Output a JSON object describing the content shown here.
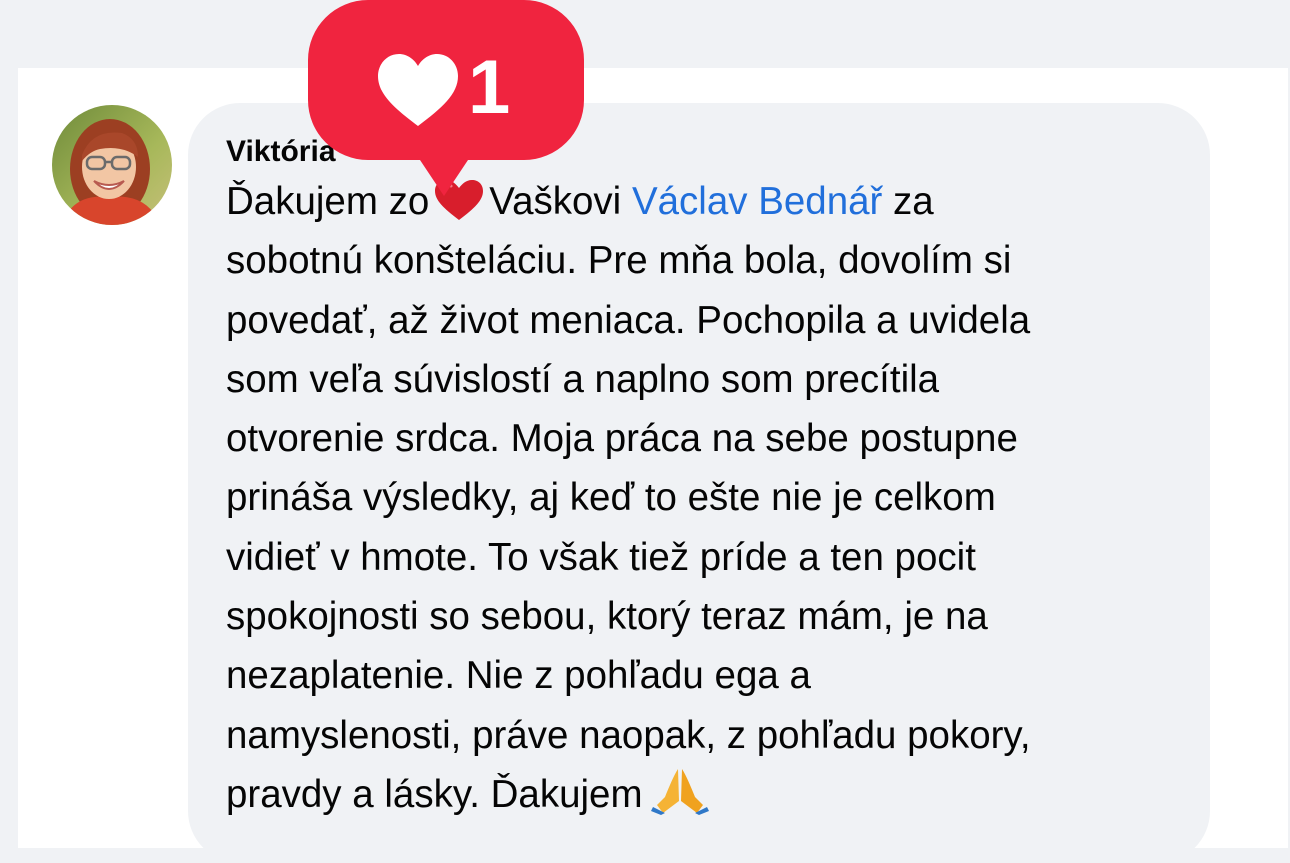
{
  "comment": {
    "author_name": "Viktória",
    "text_lines": [
      {
        "before": "Ďakujem zo",
        "emoji": "heart",
        "after": "Vaškovi",
        "mention": "Václav Bednář",
        "tail": "za"
      },
      "sobotnú konšteláciu. Pre mňa bola, dovolím si",
      "povedať, až život meniaca. Pochopila a uvidela",
      "som veľa súvislostí a naplno som precítila",
      "otvorenie srdca. Moja práca na sebe postupne",
      "prináša výsledky, aj keď to ešte nie je celkom",
      "vidieť v hmote. To však tiež príde a ten pocit",
      "spokojnosti so sebou, ktorý teraz mám, je na",
      "nezaplatenie. Nie z pohľadu ega a",
      "namyslenosti, práve naopak, z pohľadu pokory,",
      {
        "before": "pravdy a lásky. Ďakujem",
        "emoji": "folded-hands"
      }
    ],
    "mention_color": "#216fdb"
  },
  "notification_badge": {
    "icon": "heart-icon",
    "count": "1",
    "color": "#f0243f"
  },
  "colors": {
    "page_background": "#f0f2f5",
    "card_background": "#ffffff",
    "bubble_background": "#f0f2f5",
    "text": "#050505"
  }
}
